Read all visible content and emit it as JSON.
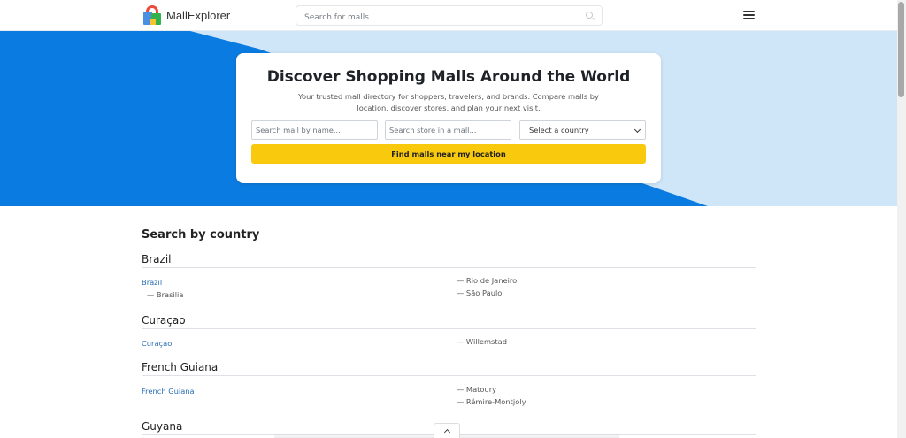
{
  "header": {
    "brand": "MallExplorer",
    "search_placeholder": "Search for malls"
  },
  "hero": {
    "title": "Discover Shopping Malls Around the World",
    "subtitle": "Your trusted mall directory for shoppers, travelers, and brands. Compare malls by location, discover stores, and plan your next visit.",
    "mall_placeholder": "Search mall by name...",
    "store_placeholder": "Search store in a mall...",
    "country_select": "Select a country",
    "near_button": "Find malls near my location"
  },
  "section_title": "Search by country",
  "countries": [
    {
      "heading": "Brazil",
      "link": "Brazil",
      "cities": [
        "— Brasilia",
        "— Rio de Janeiro",
        "— São Paulo"
      ]
    },
    {
      "heading": "Curaçao",
      "link": "Curaçao",
      "cities": [
        "— Willemstad"
      ]
    },
    {
      "heading": "French Guiana",
      "link": "French Guiana",
      "cities": [
        "— Matoury",
        "— Rémire-Montjoly"
      ]
    },
    {
      "heading": "Guyana"
    }
  ],
  "colors": {
    "hero_blue": "#0a7be0",
    "hero_light": "#cfe5f8",
    "button_yellow": "#f9c90e",
    "link_blue": "#2a6fb5"
  },
  "icons": [
    "logo-bag-icon",
    "search-icon",
    "hamburger-menu-icon",
    "chevron-down-icon",
    "chevron-up-icon"
  ]
}
